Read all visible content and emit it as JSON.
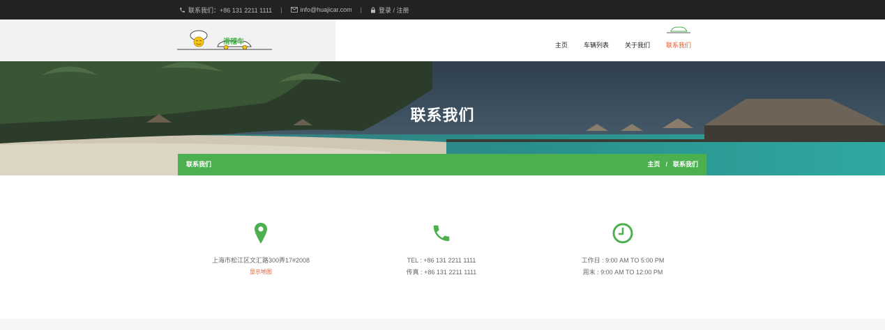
{
  "topbar": {
    "phone": "联系我们：+86 131 2211 1111",
    "sep1": "|",
    "email": "info@huajicar.com",
    "sep2": "|",
    "login": "登录 / 注册"
  },
  "logo": {
    "text": "滑稽车"
  },
  "nav": {
    "items": [
      {
        "label": "主页"
      },
      {
        "label": "车辆列表"
      },
      {
        "label": "关于我们"
      },
      {
        "label": "联系我们"
      }
    ]
  },
  "hero": {
    "title": "联系我们",
    "crumb_title": "联系我们",
    "crumb_home": "主页",
    "crumb_sep": "/",
    "crumb_current": "联系我们"
  },
  "contact": {
    "address": "上海市松江区文汇路300弄17#2008",
    "map_link": "显示地图",
    "tel": "TEL : +86 131 2211 1111",
    "fax": "传真 : +86 131 2211 1111",
    "workday": "工作日 : 9:00 AM TO 5:00 PM",
    "weekend": "周末 : 9:00 AM TO 12:00 PM"
  },
  "colors": {
    "accent_green": "#4caf50",
    "accent_orange": "#e85a2a",
    "topbar_bg": "#222222"
  }
}
